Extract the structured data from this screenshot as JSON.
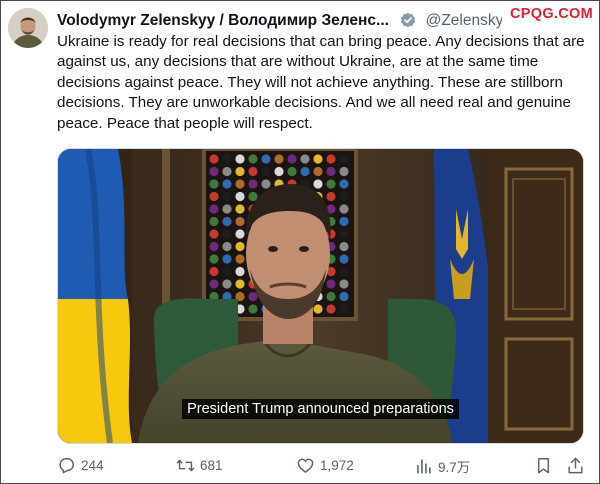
{
  "tweet": {
    "display_name": "Volodymyr Zelenskyy / Володимир Зеленс...",
    "handle": "@Zelensky...",
    "text": "Ukraine is ready for real decisions that can bring peace. Any decisions that are against us, any decisions that are without Ukraine, are at the same time decisions against peace. They will not achieve anything. These are stillborn decisions. They are unworkable decisions. And we all need real and genuine peace. Peace that people will respect."
  },
  "watermark": "CPQG.COM",
  "video": {
    "caption": "President Trump announced preparations"
  },
  "actions": {
    "replies": "244",
    "reposts": "681",
    "likes": "1,972",
    "views": "9.7万"
  },
  "colors": {
    "verified": "#829aab",
    "muted": "#536471",
    "watermark": "#e01e2f",
    "flag_blue": "#1f5bb3",
    "flag_yellow": "#f6c90e"
  },
  "icons": [
    "verified-badge-icon",
    "more-icon",
    "reply-icon",
    "repost-icon",
    "like-icon",
    "views-icon",
    "bookmark-icon",
    "share-icon"
  ]
}
